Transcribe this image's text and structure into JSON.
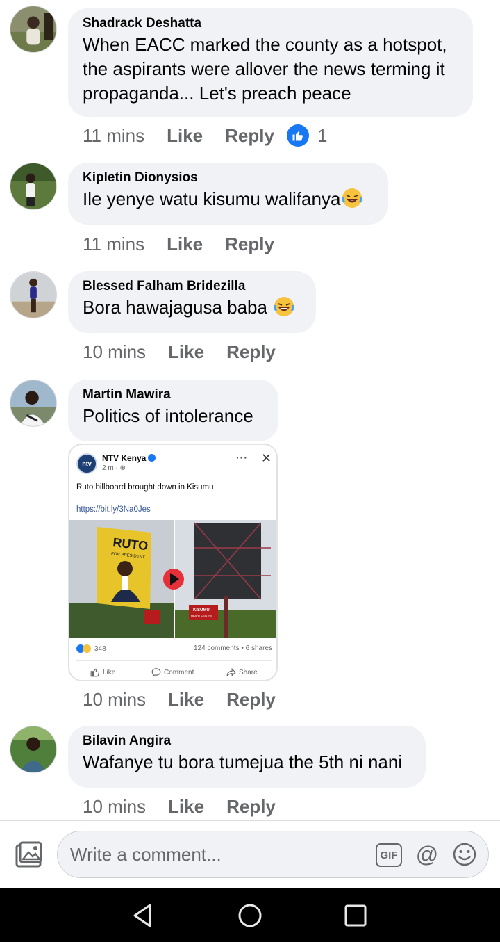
{
  "comments": [
    {
      "author": "Shadrack Deshatta",
      "lines": [
        "When EACC marked the county as a hotspot,",
        "the aspirants were allover the news terming it",
        "propaganda... Let's preach peace"
      ],
      "time": "11 mins",
      "like_label": "Like",
      "reply_label": "Reply",
      "like_count": "1"
    },
    {
      "author": "Kipletin Dionysios",
      "text": "Ile yenye watu kisumu walifanya",
      "time": "11 mins",
      "like_label": "Like",
      "reply_label": "Reply"
    },
    {
      "author": "Blessed Falham Bridezilla",
      "text": "Bora hawajagusa baba",
      "time": "10 mins",
      "like_label": "Like",
      "reply_label": "Reply"
    },
    {
      "author": "Martin Mawira",
      "text": "Politics of intolerance",
      "time": "10 mins",
      "like_label": "Like",
      "reply_label": "Reply"
    },
    {
      "author": "Bilavin Angira",
      "text": "Wafanye tu bora tumejua the 5th ni nani",
      "time": "10 mins",
      "like_label": "Like",
      "reply_label": "Reply"
    }
  ],
  "attachment": {
    "logo_text": "ntv",
    "page_name": "NTV Kenya",
    "time": "2 m ·",
    "more": "···",
    "close": "✕",
    "title": "Ruto billboard brought down in Kisumu",
    "link": "https://bit.ly/3Na0Jes",
    "billboard_text_1": "RUTO",
    "billboard_text_2": "FOR PRESIDENT",
    "sign_text": "KISUMU",
    "sign_text_2": "HEART CENTRE",
    "reaction_count": "348",
    "comments_shares": "124 comments • 6 shares",
    "like_label": "Like",
    "comment_label": "Comment",
    "share_label": "Share"
  },
  "composer": {
    "placeholder": "Write a comment...",
    "gif_label": "GIF",
    "at_label": "@"
  },
  "colors": {
    "bubble": "#f0f2f5",
    "accent": "#1877f2",
    "muted": "#65676b",
    "navbar": "#000000"
  },
  "icons": [
    "photo-icon",
    "gif-icon",
    "mention-icon",
    "emoji-icon",
    "nav-back-icon",
    "nav-home-icon",
    "nav-recents-icon",
    "like-thumb-icon",
    "laughing-emoji-icon"
  ]
}
